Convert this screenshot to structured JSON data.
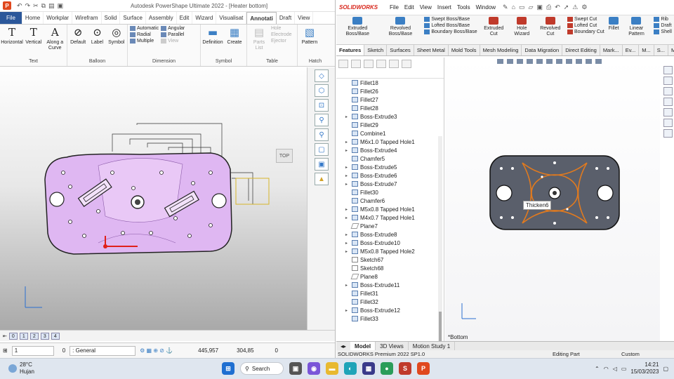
{
  "powershape": {
    "title": "Autodesk PowerShape Ultimate 2022 - [Heater bottom]",
    "tabs": [
      "File",
      "Home",
      "Workplar",
      "Wirefram",
      "Solid",
      "Surface",
      "Assembly",
      "Edit",
      "Wizard",
      "Visualisat",
      "Annotati",
      "Draft",
      "View"
    ],
    "active_tab": "Annotati",
    "ribbon": {
      "text": {
        "group": "Text",
        "horizontal": "Horizontal",
        "vertical": "Vertical",
        "along_curve": "Along a Curve"
      },
      "balloon": {
        "group": "Balloon",
        "default": "Default",
        "label": "Label",
        "symbol": "Symbol"
      },
      "dimension": {
        "group": "Dimension",
        "automatic": "Automatic",
        "radial": "Radial",
        "multiple": "Multiple",
        "angular": "Angular",
        "parallel": "Parallel",
        "view": "View"
      },
      "symbol": {
        "group": "Symbol",
        "definition": "Definition",
        "create": "Create"
      },
      "table": {
        "group": "Table",
        "parts_list": "Parts List",
        "hole": "Hole",
        "electrode": "Electrode",
        "ejector": "Ejector"
      },
      "hatch": {
        "group": "Hatch",
        "pattern": "Pattern"
      }
    },
    "viewport": {
      "view_cube_label": "TOP"
    },
    "pages": [
      "0",
      "1",
      "2",
      "3",
      "4"
    ],
    "status": {
      "level": "1",
      "general_prefix": "0",
      "general": ": General",
      "x": "445,957",
      "y": "304,85",
      "z": "0"
    }
  },
  "solidworks": {
    "logo": "SOLIDWORKS",
    "menu": [
      "File",
      "Edit",
      "View",
      "Insert",
      "Tools",
      "Window"
    ],
    "commands": {
      "extruded_boss": "Extruded Boss/Base",
      "revolved_boss": "Revolved Boss/Base",
      "swept_boss": "Swept Boss/Base",
      "lofted_boss": "Lofted Boss/Base",
      "boundary_boss": "Boundary Boss/Base",
      "extruded_cut": "Extruded Cut",
      "hole_wizard": "Hole Wizard",
      "revolved_cut": "Revolved Cut",
      "swept_cut": "Swept Cut",
      "lofted_cut": "Lofted Cut",
      "boundary_cut": "Boundary Cut",
      "fillet": "Fillet",
      "linear_pattern": "Linear Pattern",
      "rib": "Rib",
      "draft": "Draft",
      "shell": "Shell"
    },
    "tabs": [
      "Features",
      "Sketch",
      "Surfaces",
      "Sheet Metal",
      "Mold Tools",
      "Mesh Modeling",
      "Data Migration",
      "Direct Editing",
      "Mark...",
      "Ev...",
      "M...",
      "S...",
      "M..."
    ],
    "active_tab": "Features",
    "tree": [
      {
        "label": "Fillet18",
        "type": "feature",
        "arrow": false
      },
      {
        "label": "Fillet26",
        "type": "feature",
        "arrow": false
      },
      {
        "label": "Fillet27",
        "type": "feature",
        "arrow": false
      },
      {
        "label": "Fillet28",
        "type": "feature",
        "arrow": false
      },
      {
        "label": "Boss-Extrude3",
        "type": "feature",
        "arrow": true
      },
      {
        "label": "Fillet29",
        "type": "feature",
        "arrow": false
      },
      {
        "label": "Combine1",
        "type": "feature",
        "arrow": false
      },
      {
        "label": "M6x1.0 Tapped Hole1",
        "type": "feature",
        "arrow": true
      },
      {
        "label": "Boss-Extrude4",
        "type": "feature",
        "arrow": true
      },
      {
        "label": "Chamfer5",
        "type": "feature",
        "arrow": false
      },
      {
        "label": "Boss-Extrude5",
        "type": "feature",
        "arrow": true
      },
      {
        "label": "Boss-Extrude6",
        "type": "feature",
        "arrow": true
      },
      {
        "label": "Boss-Extrude7",
        "type": "feature",
        "arrow": true
      },
      {
        "label": "Fillet30",
        "type": "feature",
        "arrow": false
      },
      {
        "label": "Chamfer6",
        "type": "feature",
        "arrow": false
      },
      {
        "label": "M5x0.8 Tapped Hole1",
        "type": "feature",
        "arrow": true
      },
      {
        "label": "M4x0.7 Tapped Hole1",
        "type": "feature",
        "arrow": true
      },
      {
        "label": "Plane7",
        "type": "plane",
        "arrow": false
      },
      {
        "label": "Boss-Extrude8",
        "type": "feature",
        "arrow": true
      },
      {
        "label": "Boss-Extrude10",
        "type": "feature",
        "arrow": true
      },
      {
        "label": "M5x0.8 Tapped Hole2",
        "type": "feature",
        "arrow": true
      },
      {
        "label": "Sketch67",
        "type": "sketch",
        "arrow": false
      },
      {
        "label": "Sketch68",
        "type": "sketch",
        "arrow": false
      },
      {
        "label": "Plane8",
        "type": "plane",
        "arrow": false
      },
      {
        "label": "Boss-Extrude11",
        "type": "feature",
        "arrow": true
      },
      {
        "label": "Fillet31",
        "type": "feature",
        "arrow": false
      },
      {
        "label": "Fillet32",
        "type": "feature",
        "arrow": false
      },
      {
        "label": "Boss-Extrude12",
        "type": "feature",
        "arrow": true
      },
      {
        "label": "Fillet33",
        "type": "feature",
        "arrow": false
      }
    ],
    "viewport": {
      "tooltip": "Thicken6",
      "view_label": "*Bottom"
    },
    "bottom_tabs": [
      "Model",
      "3D Views",
      "Motion Study 1"
    ],
    "active_bottom_tab": "Model",
    "status": {
      "version": "SOLIDWORKS Premium 2022 SP1.0",
      "mode": "Editing Part",
      "units": "Custom"
    }
  },
  "taskbar": {
    "weather_temp": "28°C",
    "weather_desc": "Hujan",
    "search": "Search",
    "time": "14:21",
    "date": "15/03/2023"
  },
  "colors": {
    "part_purple": "#e0b8f4",
    "sw_part": "#555a66",
    "sw_highlight": "#e07a1f",
    "accent_blue": "#2b579a"
  }
}
